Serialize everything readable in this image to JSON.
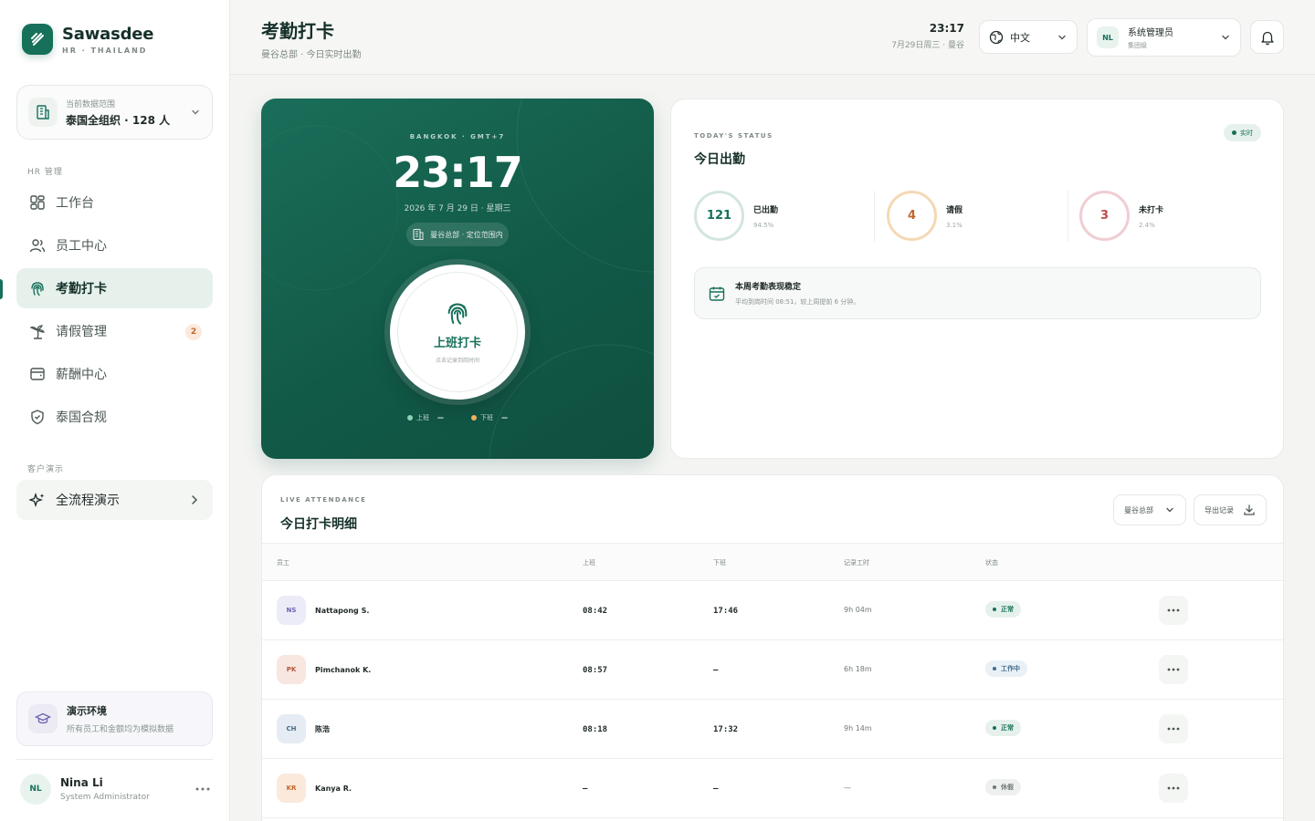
{
  "brand": {
    "name": "Sawasdee",
    "sub": "HR · THAILAND"
  },
  "scope": {
    "label": "当前数据范围",
    "value": "泰国全组织 · 128 人"
  },
  "sidebar": {
    "section_hr": "HR 管理",
    "items": [
      {
        "label": "工作台",
        "icon": "dashboard-grid-icon"
      },
      {
        "label": "员工中心",
        "icon": "users-icon"
      },
      {
        "label": "考勤打卡",
        "icon": "fingerprint-icon",
        "active": true
      },
      {
        "label": "请假管理",
        "icon": "palm-tree-icon",
        "badge": "2"
      },
      {
        "label": "薪酬中心",
        "icon": "wallet-icon"
      },
      {
        "label": "泰国合规",
        "icon": "shield-check-icon"
      }
    ],
    "section_demo": "客户演示",
    "demo_item": {
      "label": "全流程演示",
      "icon": "sparkles-icon"
    },
    "env": {
      "title": "演示环境",
      "desc": "所有员工和金额均为模拟数据"
    },
    "user": {
      "initials": "NL",
      "name": "Nina Li",
      "role": "System Administrator"
    }
  },
  "header": {
    "title": "考勤打卡",
    "subtitle": "曼谷总部 · 今日实时出勤",
    "clock": "23:17",
    "date": "7月29日周三 · 曼谷",
    "language": "中文",
    "account": {
      "initials": "NL",
      "name": "系统管理员",
      "sub": "集团级"
    }
  },
  "punch": {
    "location": "BANGKOK · GMT+7",
    "time": "23:17",
    "date": "2026 年 7 月 29 日 · 星期三",
    "geo": "曼谷总部 · 定位范围内",
    "button_label": "上班打卡",
    "button_hint": "点击记录到岗时间",
    "legend": [
      {
        "label": "上班",
        "value": "—",
        "color": "#8fd0b6"
      },
      {
        "label": "下班",
        "value": "—",
        "color": "#f2b15a"
      }
    ]
  },
  "status": {
    "eyebrow": "TODAY'S STATUS",
    "title": "今日出勤",
    "live": "实时",
    "stats": [
      {
        "value": "121",
        "label": "已出勤",
        "pct": "94.5%",
        "color": "#16705a",
        "ring": "#d3e6dd"
      },
      {
        "value": "4",
        "label": "请假",
        "pct": "3.1%",
        "color": "#c1682b",
        "ring": "#f4d9b4"
      },
      {
        "value": "3",
        "label": "未打卡",
        "pct": "2.4%",
        "color": "#c24a4a",
        "ring": "#f0cdd3"
      }
    ],
    "insight": {
      "title": "本周考勤表现稳定",
      "desc": "平均到岗时间 08:51，较上周提前 6 分钟。"
    }
  },
  "table": {
    "eyebrow": "LIVE ATTENDANCE",
    "title": "今日打卡明细",
    "filter": "曼谷总部",
    "export": "导出记录",
    "columns": [
      "员工",
      "上班",
      "下班",
      "记录工时",
      "状态"
    ],
    "rows": [
      {
        "initials": "NS",
        "name": "Nattapong S.",
        "in": "08:42",
        "out": "17:46",
        "hours": "9h 04m",
        "status": "正常",
        "av_bg": "#ecebf8",
        "av_fg": "#6a64b0",
        "st_bg": "#e6f1ec",
        "st_fg": "#16705a",
        "st_dot": "#16705a"
      },
      {
        "initials": "PK",
        "name": "Pimchanok K.",
        "in": "08:57",
        "out": "–",
        "hours": "6h 18m",
        "status": "工作中",
        "av_bg": "#f8e6e0",
        "av_fg": "#b2563c",
        "st_bg": "#e9f0f6",
        "st_fg": "#3f6b8a",
        "st_dot": "#3f6b8a"
      },
      {
        "initials": "CH",
        "name": "陈浩",
        "in": "08:18",
        "out": "17:32",
        "hours": "9h 14m",
        "status": "正常",
        "av_bg": "#e5ecf3",
        "av_fg": "#4a6a86",
        "st_bg": "#e6f1ec",
        "st_fg": "#16705a",
        "st_dot": "#16705a"
      },
      {
        "initials": "KR",
        "name": "Kanya R.",
        "in": "–",
        "out": "–",
        "hours": "—",
        "status": "休假",
        "av_bg": "#fbe9dc",
        "av_fg": "#c1682b",
        "st_bg": "#eef0ef",
        "st_fg": "#6e7974",
        "st_dot": "#6e7974"
      }
    ]
  }
}
